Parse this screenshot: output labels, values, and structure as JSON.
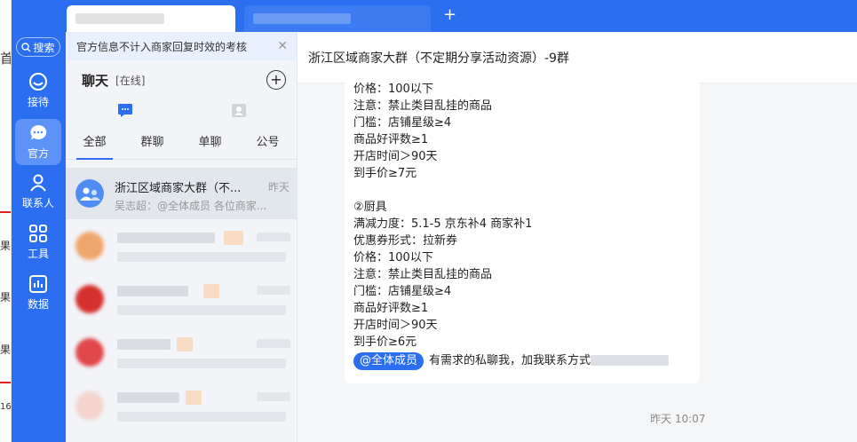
{
  "colors": {
    "accent": "#2b6ff0",
    "nav_active": "#5d93f7"
  },
  "nav": {
    "search_label": "搜索",
    "items": [
      {
        "label": "接待",
        "icon": "reception-icon"
      },
      {
        "label": "官方",
        "icon": "chat-bubble-icon"
      },
      {
        "label": "联系人",
        "icon": "person-icon"
      },
      {
        "label": "工具",
        "icon": "grid-icon"
      },
      {
        "label": "数据",
        "icon": "chart-icon"
      }
    ]
  },
  "chat_list": {
    "notice": "官方信息不计入商家回复时效的考核",
    "title": "聊天",
    "status": "[在线]",
    "tabs": [
      "全部",
      "群聊",
      "单聊",
      "公号"
    ],
    "conversations": [
      {
        "name": "浙江区域商家大群（不...",
        "time": "昨天",
        "preview": "吴志超：@全体成员 各位商家..."
      }
    ]
  },
  "main": {
    "title": "浙江区域商家大群（不定期分享活动资源）-9群",
    "lines": [
      "价格：100以下",
      "注意：禁止类目乱挂的商品",
      "门槛：店铺星级≥4",
      "商品好评数≥1",
      "开店时间＞90天",
      "到手价≥7元",
      "",
      "②厨具",
      "满减力度：5.1-5 京东补4 商家补1",
      "优惠券形式：拉新券",
      "价格：100以下",
      "注意：禁止类目乱挂的商品",
      "门槛：店铺星级≥4",
      "商品好评数≥1",
      "开店时间＞90天",
      "到手价≥6元"
    ],
    "mention": "@全体成员",
    "mention_text": "有需求的私聊我，加我联系方式",
    "time": "昨天 10:07"
  },
  "edge_chars": [
    "首",
    "果",
    "果",
    "果",
    "16"
  ]
}
